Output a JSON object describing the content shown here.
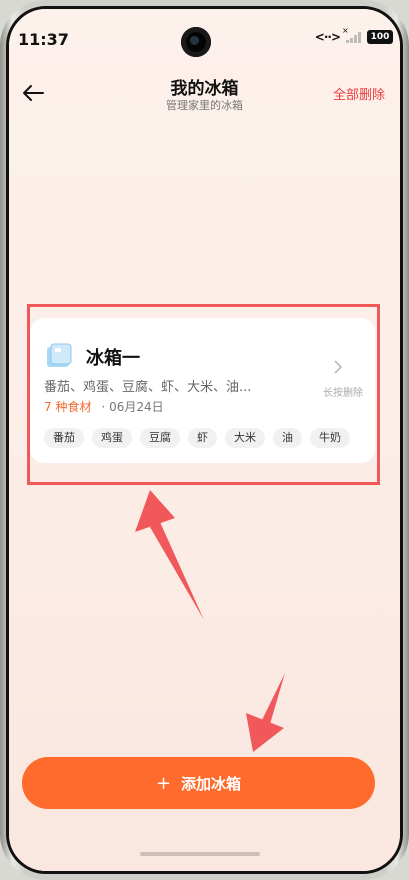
{
  "status": {
    "time": "11:37",
    "link": "<··>",
    "battery": "100"
  },
  "header": {
    "title": "我的冰箱",
    "subtitle": "管理家里的冰箱",
    "delete_all": "全部删除"
  },
  "fridge": {
    "name": "冰箱一",
    "summary": "番茄、鸡蛋、豆腐、虾、大米、油...",
    "count": "7 种食材",
    "date": "· 06月24日",
    "hint": "长按删除",
    "items": [
      "番茄",
      "鸡蛋",
      "豆腐",
      "虾",
      "大米",
      "油",
      "牛奶"
    ]
  },
  "add_button": {
    "label": "添加冰箱",
    "icon": "plus-icon"
  },
  "colors": {
    "accent": "#ff6b2c",
    "danger": "#ee3b3b",
    "annotation": "#f0585a"
  }
}
